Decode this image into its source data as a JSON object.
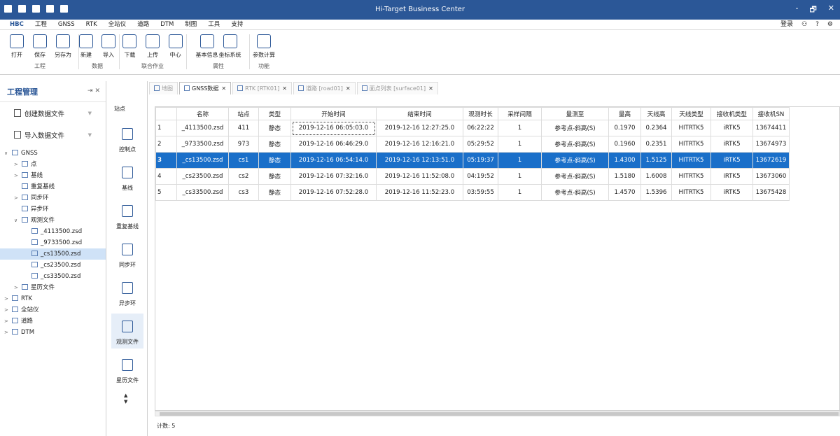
{
  "window": {
    "title": "Hi-Target Business Center",
    "controls": [
      "-",
      "🗗",
      "✕"
    ]
  },
  "menu": {
    "items": [
      "HBC",
      "工程",
      "GNSS",
      "RTK",
      "全站仪",
      "道路",
      "DTM",
      "制图",
      "工具",
      "支持"
    ],
    "active": "工程",
    "right": {
      "login": "登录",
      "user": "⚇",
      "help": "?",
      "settings": "⚙"
    }
  },
  "ribbon": {
    "groups": [
      {
        "label": "工程",
        "buttons": [
          "打开",
          "保存",
          "另存为"
        ]
      },
      {
        "label": "数据",
        "buttons": [
          "新建",
          "导入"
        ]
      },
      {
        "label": "联合作业",
        "buttons": [
          "下载",
          "上传",
          "中心"
        ]
      },
      {
        "label": "属性",
        "buttons": [
          "基本信息",
          "坐标系统"
        ]
      },
      {
        "label": "功能",
        "buttons": [
          "参数计算"
        ]
      }
    ]
  },
  "left_panel": {
    "title": "工程管理",
    "pin": "⇥ ✕",
    "create": "创建数据文件",
    "import": "导入数据文件",
    "tree": [
      {
        "label": "GNSS",
        "level": 0,
        "twisty": "∨"
      },
      {
        "label": "点",
        "level": 1,
        "twisty": ">"
      },
      {
        "label": "基线",
        "level": 1,
        "twisty": ">"
      },
      {
        "label": "重复基线",
        "level": 1,
        "twisty": ""
      },
      {
        "label": "同步环",
        "level": 1,
        "twisty": ">"
      },
      {
        "label": "异步环",
        "level": 1,
        "twisty": ""
      },
      {
        "label": "观测文件",
        "level": 1,
        "twisty": "∨"
      },
      {
        "label": "_4113500.zsd",
        "level": 2,
        "twisty": ""
      },
      {
        "label": "_9733500.zsd",
        "level": 2,
        "twisty": ""
      },
      {
        "label": "_cs13500.zsd",
        "level": 2,
        "twisty": "",
        "selected": true
      },
      {
        "label": "_cs23500.zsd",
        "level": 2,
        "twisty": ""
      },
      {
        "label": "_cs33500.zsd",
        "level": 2,
        "twisty": ""
      },
      {
        "label": "星历文件",
        "level": 1,
        "twisty": ">"
      },
      {
        "label": "RTK",
        "level": 0,
        "twisty": ">"
      },
      {
        "label": "全站仪",
        "level": 0,
        "twisty": ">"
      },
      {
        "label": "道路",
        "level": 0,
        "twisty": ">"
      },
      {
        "label": "DTM",
        "level": 0,
        "twisty": ">"
      }
    ]
  },
  "icon_bar": {
    "top_label": "站点",
    "items": [
      "控制点",
      "基线",
      "重复基线",
      "同步环",
      "异步环",
      "观测文件",
      "星历文件"
    ],
    "active": "观测文件",
    "scroll": "▲\n▼"
  },
  "tabs": [
    {
      "label": "地图",
      "close": ""
    },
    {
      "label": "GNSS数据",
      "close": "✕",
      "active": true
    },
    {
      "label": "RTK [RTK01]",
      "close": "✕"
    },
    {
      "label": "道路 [road01]",
      "close": "✕"
    },
    {
      "label": "面点列表 [surface01]",
      "close": "✕"
    }
  ],
  "table": {
    "columns": [
      "",
      "名称",
      "站点",
      "类型",
      "开始时间",
      "结束时间",
      "观测时长",
      "采样间隔",
      "量测至",
      "量高",
      "天线高",
      "天线类型",
      "接收机类型",
      "接收机SN"
    ],
    "rows": [
      [
        "1",
        "_4113500.zsd",
        "411",
        "静态",
        "2019-12-16 06:05:03.0",
        "2019-12-16 12:27:25.0",
        "06:22:22",
        "1",
        "参考点-斜高(S)",
        "0.1970",
        "0.2364",
        "HITRTK5",
        "iRTK5",
        "13674411"
      ],
      [
        "2",
        "_9733500.zsd",
        "973",
        "静态",
        "2019-12-16 06:46:29.0",
        "2019-12-16 12:16:21.0",
        "05:29:52",
        "1",
        "参考点-斜高(S)",
        "0.1960",
        "0.2351",
        "HITRTK5",
        "iRTK5",
        "13674973"
      ],
      [
        "3",
        "_cs13500.zsd",
        "cs1",
        "静态",
        "2019-12-16 06:54:14.0",
        "2019-12-16 12:13:51.0",
        "05:19:37",
        "1",
        "参考点-斜高(S)",
        "1.4300",
        "1.5125",
        "HITRTK5",
        "iRTK5",
        "13672619"
      ],
      [
        "4",
        "_cs23500.zsd",
        "cs2",
        "静态",
        "2019-12-16 07:32:16.0",
        "2019-12-16 11:52:08.0",
        "04:19:52",
        "1",
        "参考点-斜高(S)",
        "1.5180",
        "1.6008",
        "HITRTK5",
        "iRTK5",
        "13673060"
      ],
      [
        "5",
        "_cs33500.zsd",
        "cs3",
        "静态",
        "2019-12-16 07:52:28.0",
        "2019-12-16 11:52:23.0",
        "03:59:55",
        "1",
        "参考点-斜高(S)",
        "1.4570",
        "1.5396",
        "HITRTK5",
        "iRTK5",
        "13675428"
      ]
    ],
    "selected_row": 3
  },
  "status": {
    "count": "计数: 5"
  },
  "colors": {
    "title_bar": "#2b5797",
    "selection": "#1a6fc9",
    "tree_selection": "#cfe2f7"
  }
}
